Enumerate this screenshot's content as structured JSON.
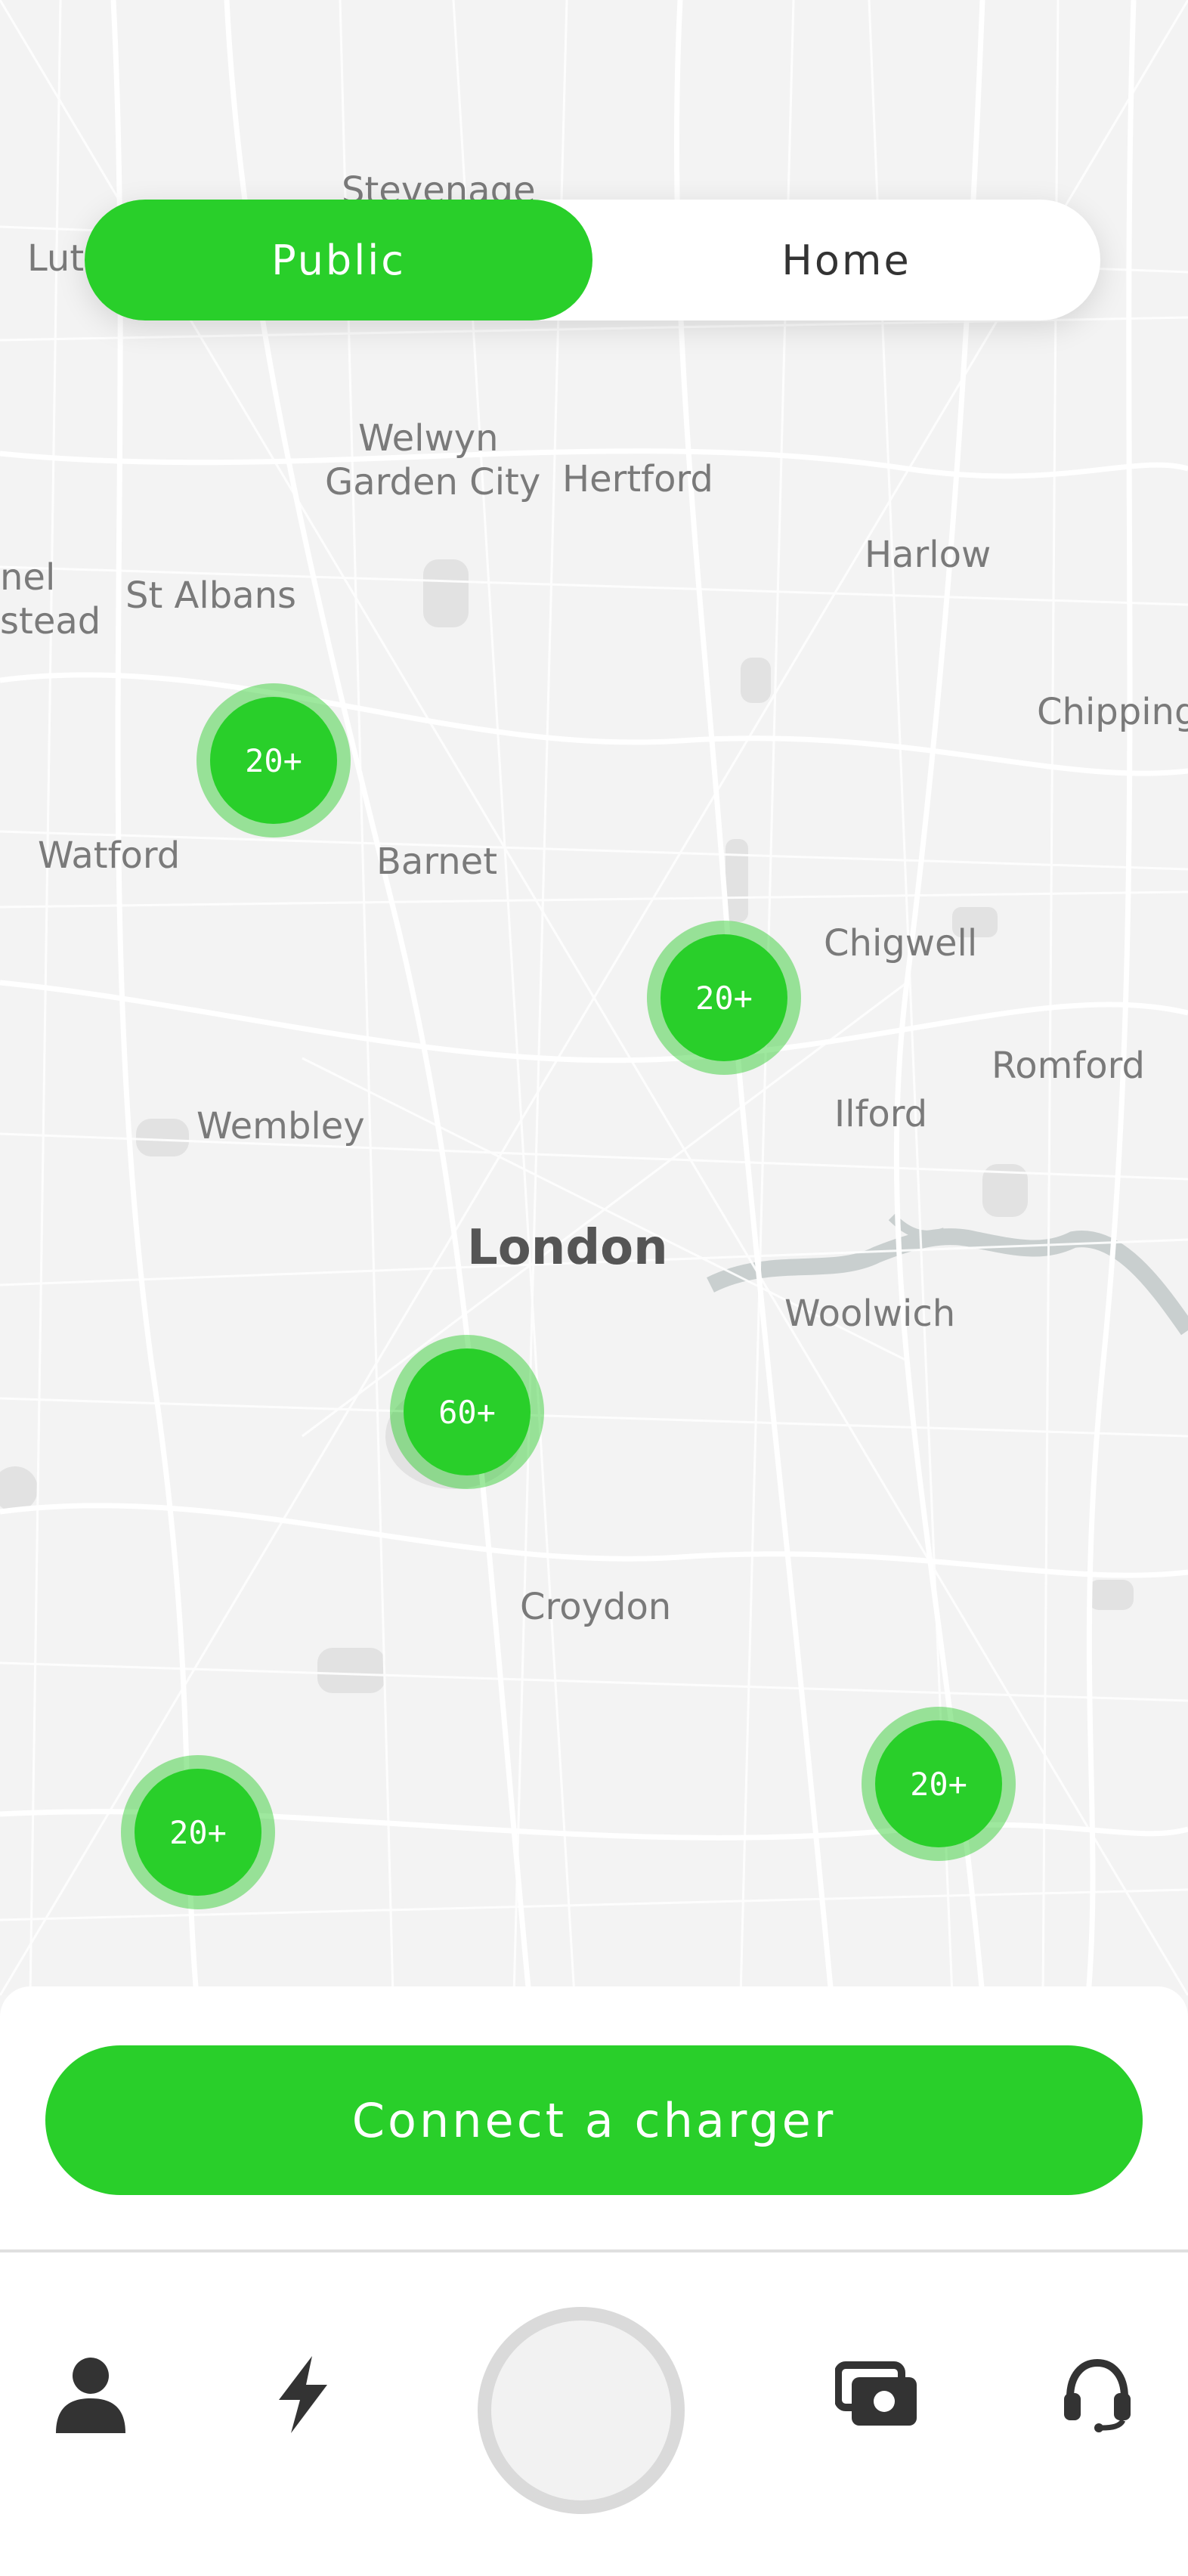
{
  "toggle": {
    "public_label": "Public",
    "home_label": "Home",
    "selected": "Public"
  },
  "map": {
    "places": [
      {
        "id": "stevenage",
        "label": "Stevenage",
        "partial": true
      },
      {
        "id": "luton",
        "label": "Lut",
        "partial": true
      },
      {
        "id": "welwyn",
        "label": "Welwyn"
      },
      {
        "id": "garden-city",
        "label": "Garden City"
      },
      {
        "id": "hertford",
        "label": "Hertford"
      },
      {
        "id": "harlow",
        "label": "Harlow"
      },
      {
        "id": "hemel",
        "label": "nel"
      },
      {
        "id": "hempstead",
        "label": "stead"
      },
      {
        "id": "st-albans",
        "label": "St Albans"
      },
      {
        "id": "chipping",
        "label": "Chipping"
      },
      {
        "id": "watford",
        "label": "Watford"
      },
      {
        "id": "barnet",
        "label": "Barnet"
      },
      {
        "id": "chigwell",
        "label": "Chigwell"
      },
      {
        "id": "romford",
        "label": "Romford"
      },
      {
        "id": "ilford",
        "label": "Ilford"
      },
      {
        "id": "wembley",
        "label": "Wembley"
      },
      {
        "id": "london",
        "label": "London"
      },
      {
        "id": "woolwich",
        "label": "Woolwich"
      },
      {
        "id": "croydon",
        "label": "Croydon"
      }
    ],
    "clusters": [
      {
        "id": "cluster-watford",
        "label": "20+"
      },
      {
        "id": "cluster-chigwell",
        "label": "20+"
      },
      {
        "id": "cluster-wimbledon",
        "label": "60+"
      },
      {
        "id": "cluster-southeast",
        "label": "20+"
      },
      {
        "id": "cluster-southwest",
        "label": "20+"
      }
    ],
    "accent": "#29cf2a"
  },
  "sheet": {
    "connect_label": "Connect a charger"
  },
  "nav": {
    "items": [
      {
        "id": "account",
        "icon": "person-icon"
      },
      {
        "id": "charging",
        "icon": "lightning-icon"
      },
      {
        "id": "scan",
        "icon": "scan-button"
      },
      {
        "id": "wallet",
        "icon": "wallet-icon"
      },
      {
        "id": "support",
        "icon": "headset-icon"
      }
    ]
  }
}
